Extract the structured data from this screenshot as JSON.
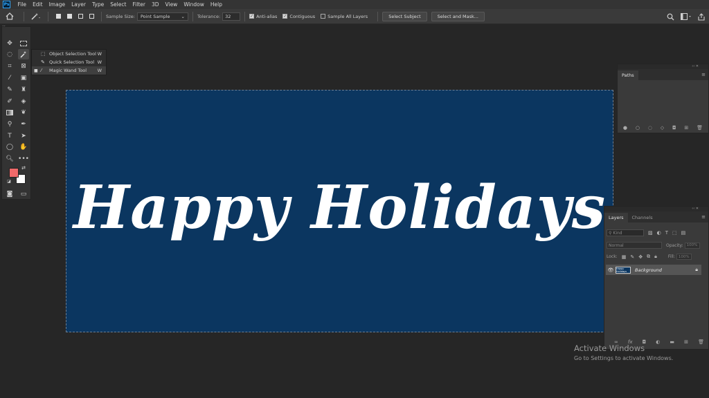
{
  "app": {
    "logo": "Ps"
  },
  "menu": [
    "File",
    "Edit",
    "Image",
    "Layer",
    "Type",
    "Select",
    "Filter",
    "3D",
    "View",
    "Window",
    "Help"
  ],
  "options": {
    "sample_size_label": "Sample Size:",
    "sample_size_value": "Point Sample",
    "tolerance_label": "Tolerance:",
    "tolerance_value": "32",
    "anti_alias_label": "Anti-alias",
    "anti_alias_checked": true,
    "contiguous_label": "Contiguous",
    "contiguous_checked": true,
    "sample_all_layers_label": "Sample All Layers",
    "sample_all_layers_checked": false,
    "select_subject_label": "Select Subject",
    "select_and_mask_label": "Select and Mask..."
  },
  "flyout": [
    {
      "label": "Object Selection Tool",
      "key": "W",
      "selected": false
    },
    {
      "label": "Quick Selection Tool",
      "key": "W",
      "selected": false
    },
    {
      "label": "Magic Wand Tool",
      "key": "W",
      "selected": true
    }
  ],
  "colors": {
    "foreground": "#f06a6a",
    "background": "#ffffff",
    "canvas": "#0b3660"
  },
  "canvas": {
    "text": "Happy Holidays"
  },
  "paths_panel": {
    "tab": "Paths"
  },
  "layers_panel": {
    "tabs": [
      "Layers",
      "Channels"
    ],
    "filter_placeholder": "Kind",
    "blend_mode": "Normal",
    "opacity_label": "Opacity:",
    "opacity_value": "100%",
    "lock_label": "Lock:",
    "fill_label": "Fill:",
    "fill_value": "100%",
    "layer_name": "Background",
    "layer_thumb_text": "Happy Holidays"
  },
  "watermark": {
    "title": "Activate Windows",
    "subtitle": "Go to Settings to activate Windows."
  }
}
